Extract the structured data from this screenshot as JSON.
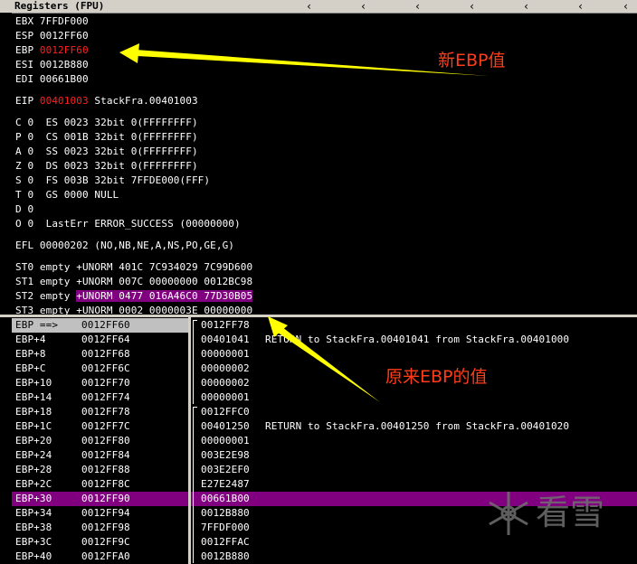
{
  "title": "Registers (FPU)",
  "registers": {
    "ebx": "EBX 7FFDF000",
    "esp": "ESP 0012FF60",
    "ebp_name": "EBP ",
    "ebp_value": "0012FF60",
    "esi": "ESI 0012B880",
    "edi": "EDI 00661B00",
    "eip_name": "EIP ",
    "eip_value": "00401003",
    "eip_comment": " StackFra.00401003"
  },
  "flags": [
    "C 0  ES 0023 32bit 0(FFFFFFFF)",
    "P 0  CS 001B 32bit 0(FFFFFFFF)",
    "A 0  SS 0023 32bit 0(FFFFFFFF)",
    "Z 0  DS 0023 32bit 0(FFFFFFFF)",
    "S 0  FS 003B 32bit 7FFDE000(FFF)",
    "T 0  GS 0000 NULL",
    "D 0",
    "O 0  LastErr ERROR_SUCCESS (00000000)"
  ],
  "efl": "EFL 00000202 (NO,NB,NE,A,NS,PO,GE,G)",
  "fpu": {
    "st0": "ST0 empty +UNORM 401C 7C934029 7C99D600",
    "st1": "ST1 empty +UNORM 007C 00000000 0012BC98",
    "st2_prefix": "ST2 empty ",
    "st2_hl": "+UNORM 0477 016A46C0 77D30B05",
    "st3": "ST3 empty +UNORM 0002 0000003E 00000000"
  },
  "stack": {
    "rows": [
      {
        "offset": "EBP ==>",
        "addr": "0012FF60",
        "value": "0012FF78",
        "comment": ""
      },
      {
        "offset": "EBP+4",
        "addr": "0012FF64",
        "value": "00401041",
        "comment": "RETURN to StackFra.00401041 from StackFra.00401000"
      },
      {
        "offset": "EBP+8",
        "addr": "0012FF68",
        "value": "00000001",
        "comment": ""
      },
      {
        "offset": "EBP+C",
        "addr": "0012FF6C",
        "value": "00000002",
        "comment": ""
      },
      {
        "offset": "EBP+10",
        "addr": "0012FF70",
        "value": "00000002",
        "comment": ""
      },
      {
        "offset": "EBP+14",
        "addr": "0012FF74",
        "value": "00000001",
        "comment": ""
      },
      {
        "offset": "EBP+18",
        "addr": "0012FF78",
        "value": "0012FFC0",
        "comment": ""
      },
      {
        "offset": "EBP+1C",
        "addr": "0012FF7C",
        "value": "00401250",
        "comment": "RETURN to StackFra.00401250 from StackFra.00401020"
      },
      {
        "offset": "EBP+20",
        "addr": "0012FF80",
        "value": "00000001",
        "comment": ""
      },
      {
        "offset": "EBP+24",
        "addr": "0012FF84",
        "value": "003E2E98",
        "comment": ""
      },
      {
        "offset": "EBP+28",
        "addr": "0012FF88",
        "value": "003E2EF0",
        "comment": ""
      },
      {
        "offset": "EBP+2C",
        "addr": "0012FF8C",
        "value": "E27E2487",
        "comment": ""
      },
      {
        "offset": "EBP+30",
        "addr": "0012FF90",
        "value": "00661B00",
        "comment": ""
      },
      {
        "offset": "EBP+34",
        "addr": "0012FF94",
        "value": "0012B880",
        "comment": ""
      },
      {
        "offset": "EBP+38",
        "addr": "0012FF98",
        "value": "7FFDF000",
        "comment": ""
      },
      {
        "offset": "EBP+3C",
        "addr": "0012FF9C",
        "value": "0012FFAC",
        "comment": ""
      },
      {
        "offset": "EBP+40",
        "addr": "0012FFA0",
        "value": "0012B880",
        "comment": ""
      }
    ]
  },
  "annotations": {
    "new_ebp": "新EBP值",
    "old_ebp": "原来EBP的值"
  },
  "watermark": "看雪",
  "colors": {
    "panel_bg": "#000000",
    "text": "#ffffff",
    "changed_register": "#ff2020",
    "highlight_row": "#800080",
    "selected_row": "#c0c0c0",
    "annotation": "#ff3d1a",
    "arrow": "#ffff00",
    "chrome": "#d4d0c8"
  },
  "icons": [
    "scroll-left-icon",
    "snowflake-logo-icon"
  ]
}
